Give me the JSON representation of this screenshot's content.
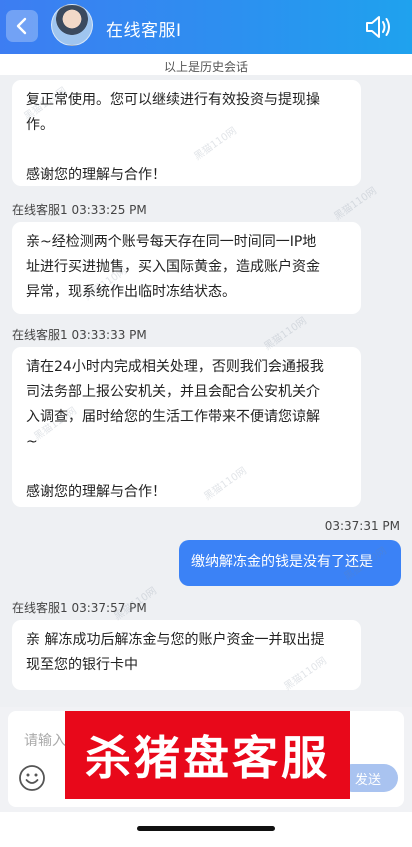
{
  "header": {
    "title": "在线客服I",
    "back_icon": "chevron-left-icon",
    "speaker_icon": "speaker-icon"
  },
  "history_label": "以上是历史会话",
  "messages": [
    {
      "side": "left",
      "text": "复正常使用。您可以继续进行有效投资与提现操\n作。\n\n感谢您的理解与合作！"
    },
    {
      "side": "left",
      "sender": "在线客服1 03:33:25 PM",
      "text": "亲~经检测两个账号每天存在同一时间同一IP地\n址进行买进抛售，买入国际黄金，造成账户资金\n异常，现系统作出临时冻结状态。"
    },
    {
      "side": "left",
      "sender": "在线客服1 03:33:33 PM",
      "text": "请在24小时内完成相关处理，否则我们会通报我\n司法务部上报公安机关，并且会配合公安机关介\n入调查，届时给您的生活工作带来不便请您谅解\n~\n\n感谢您的理解与合作！"
    },
    {
      "side": "right",
      "time": "03:37:31 PM",
      "text": "缴纳解冻金的钱是没有了还是"
    },
    {
      "side": "left",
      "sender": "在线客服1 03:37:57 PM",
      "text": "亲 解冻成功后解冻金与您的账户资金一并取出提\n现至您的银行卡中"
    }
  ],
  "input": {
    "placeholder": "请输入",
    "send_label": "发送",
    "emoji_icon": "emoji-icon"
  },
  "banner": {
    "text": "杀猪盘客服"
  },
  "watermark": "黑猫110网",
  "colors": {
    "header_start": "#3d7df2",
    "header_end": "#1fa2ee",
    "my_bubble": "#3b82f6",
    "banner": "#e8081a",
    "send_button": "#a9c3f0"
  }
}
